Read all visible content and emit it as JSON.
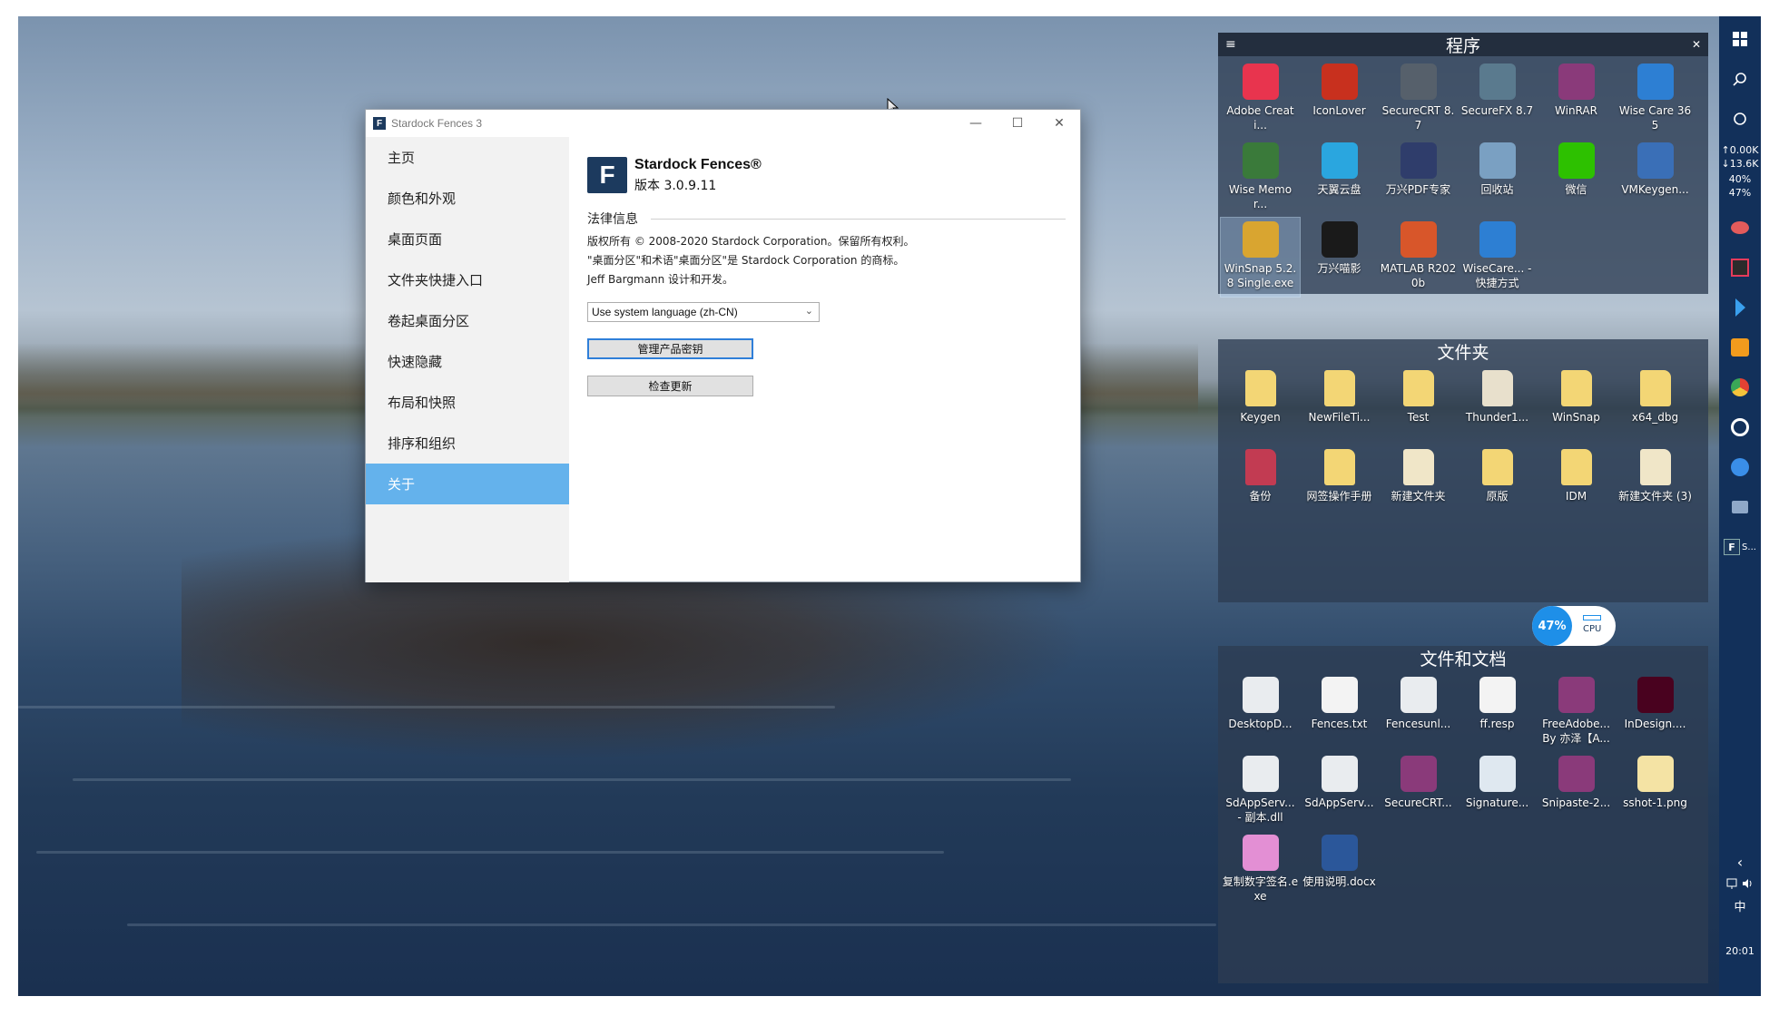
{
  "window": {
    "title": "Stardock Fences 3",
    "minimize": "—",
    "maximize": "☐",
    "close": "✕",
    "nav": [
      "主页",
      "颜色和外观",
      "桌面页面",
      "文件夹快捷入口",
      "卷起桌面分区",
      "快速隐藏",
      "布局和快照",
      "排序和组织",
      "关于"
    ],
    "active_nav": "关于",
    "product_name": "Stardock Fences®",
    "version": "版本 3.0.9.11",
    "legal_heading": "法律信息",
    "legal_lines": [
      "版权所有 © 2008-2020 Stardock Corporation。保留所有权利。",
      "\"桌面分区\"和术语\"桌面分区\"是 Stardock Corporation 的商标。",
      "Jeff Bargmann 设计和开发。"
    ],
    "language_value": "Use system language (zh-CN)",
    "manage_key_label": "管理产品密钥",
    "check_update_label": "检查更新"
  },
  "fences": {
    "programs": {
      "title": "程序",
      "menu_icon": "≡",
      "close_icon": "✕",
      "items": [
        {
          "label": "Adobe Creati...",
          "icon": "adobe-cc-icon",
          "color": "#e8344e"
        },
        {
          "label": "IconLover",
          "icon": "iconlover-icon",
          "color": "#c8301e"
        },
        {
          "label": "SecureCRT 8.7",
          "icon": "securecrt-icon",
          "color": "#56606b"
        },
        {
          "label": "SecureFX 8.7",
          "icon": "securefx-icon",
          "color": "#5a7a8e"
        },
        {
          "label": "WinRAR",
          "icon": "winrar-icon",
          "color": "#8a3a7a"
        },
        {
          "label": "Wise Care 365",
          "icon": "wisecare-icon",
          "color": "#2d7fd3"
        },
        {
          "label": "Wise Memor...",
          "icon": "wise-memory-icon",
          "color": "#3a7a3a"
        },
        {
          "label": "天翼云盘",
          "icon": "tianyi-cloud-icon",
          "color": "#2aa6df"
        },
        {
          "label": "万兴PDF专家",
          "icon": "wondershare-pdf-icon",
          "color": "#2f3d6b"
        },
        {
          "label": "回收站",
          "icon": "recycle-bin-icon",
          "color": "#7aa0c2"
        },
        {
          "label": "微信",
          "icon": "wechat-icon",
          "color": "#2dc100"
        },
        {
          "label": "VMKeygen...",
          "icon": "vmware-icon",
          "color": "#3a6fb7"
        },
        {
          "label": "WinSnap 5.2.8 Single.exe",
          "icon": "winsnap-icon",
          "color": "#d9a530"
        },
        {
          "label": "万兴喵影",
          "icon": "filmora-icon",
          "color": "#1a1a1a"
        },
        {
          "label": "MATLAB R2020b",
          "icon": "matlab-icon",
          "color": "#d8562a"
        },
        {
          "label": "WiseCare... - 快捷方式",
          "icon": "wisecare-shortcut-icon",
          "color": "#2d7fd3"
        }
      ]
    },
    "folders": {
      "title": "文件夹",
      "items": [
        {
          "label": "Keygen",
          "icon": "folder-icon",
          "color": "#f3d675"
        },
        {
          "label": "NewFileTi...",
          "icon": "folder-icon",
          "color": "#f3d675"
        },
        {
          "label": "Test",
          "icon": "folder-icon",
          "color": "#f3d675"
        },
        {
          "label": "Thunder1...",
          "icon": "folder-icon",
          "color": "#e8e0cc"
        },
        {
          "label": "WinSnap",
          "icon": "folder-icon",
          "color": "#f3d675"
        },
        {
          "label": "x64_dbg",
          "icon": "folder-icon",
          "color": "#f3d675"
        },
        {
          "label": "备份",
          "icon": "folder-icon",
          "color": "#c23b52"
        },
        {
          "label": "网签操作手册",
          "icon": "folder-icon",
          "color": "#f3d675"
        },
        {
          "label": "新建文件夹",
          "icon": "folder-icon",
          "color": "#f0e6c8"
        },
        {
          "label": "原版",
          "icon": "folder-icon",
          "color": "#f3d675"
        },
        {
          "label": "IDM",
          "icon": "folder-icon",
          "color": "#f3d675"
        },
        {
          "label": "新建文件夹 (3)",
          "icon": "folder-icon",
          "color": "#f0e6c8"
        }
      ]
    },
    "docs": {
      "title": "文件和文档",
      "items": [
        {
          "label": "DesktopD...",
          "icon": "settings-file-icon",
          "color": "#e9ecef"
        },
        {
          "label": "Fences.txt",
          "icon": "text-file-icon",
          "color": "#f3f3f3"
        },
        {
          "label": "Fencesunl...",
          "icon": "settings-file-icon",
          "color": "#e9ecef"
        },
        {
          "label": "ff.resp",
          "icon": "blank-file-icon",
          "color": "#f3f3f3"
        },
        {
          "label": "FreeAdobe... By 亦泽【A...",
          "icon": "winrar-icon",
          "color": "#8a3a7a"
        },
        {
          "label": "InDesign....",
          "icon": "indesign-icon",
          "color": "#49021f"
        },
        {
          "label": "SdAppServ... - 副本.dll",
          "icon": "settings-file-icon",
          "color": "#e9ecef"
        },
        {
          "label": "SdAppServ...",
          "icon": "settings-file-icon",
          "color": "#e9ecef"
        },
        {
          "label": "SecureCRT...",
          "icon": "winrar-icon",
          "color": "#8a3a7a"
        },
        {
          "label": "Signature...",
          "icon": "image-file-icon",
          "color": "#dfe8f0"
        },
        {
          "label": "Snipaste-2...",
          "icon": "winrar-icon",
          "color": "#8a3a7a"
        },
        {
          "label": "sshot-1.png",
          "icon": "image-file-icon",
          "color": "#f4e3a4"
        },
        {
          "label": "复制数字签名.exe",
          "icon": "butterfly-icon",
          "color": "#e38fd4"
        },
        {
          "label": "使用说明.docx",
          "icon": "word-doc-icon",
          "color": "#2b579a"
        }
      ]
    }
  },
  "cpu_widget": {
    "percent": "47%",
    "label": "CPU"
  },
  "taskbar": {
    "net_up": "↑0.00K",
    "net_down": "↓13.6K",
    "pct1": "40%",
    "pct2": "47%",
    "pinned_app_label": "S...",
    "ime": "中",
    "time": "20:01",
    "chevron": "‹"
  }
}
